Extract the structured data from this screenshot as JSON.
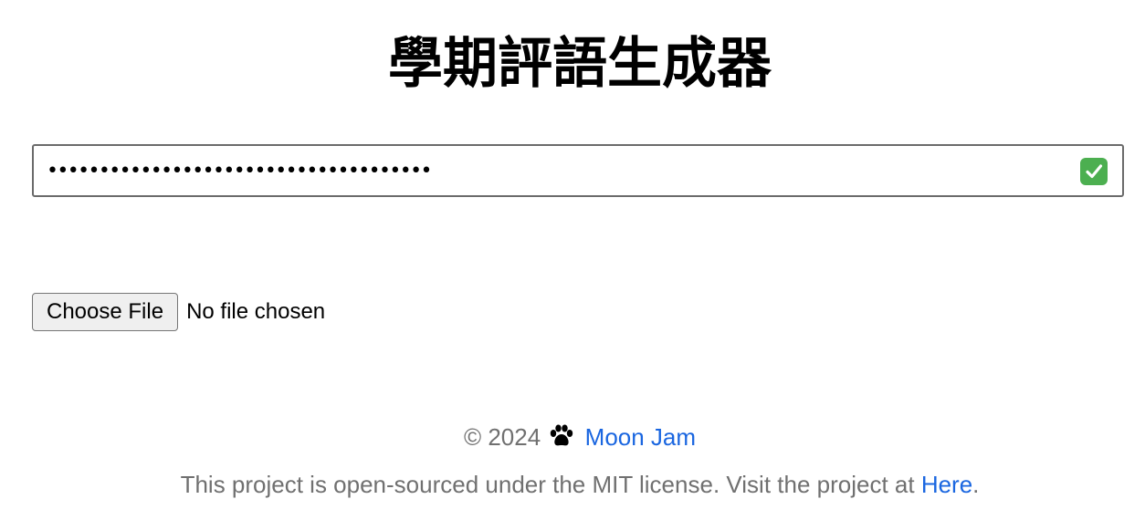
{
  "header": {
    "title": "學期評語生成器"
  },
  "api_key": {
    "value": "•••••••••••••••••••••••••••••••••••••",
    "status_icon": "check-mark-icon",
    "status_color": "#4caf50"
  },
  "file_input": {
    "button_label": "Choose File",
    "status_text": "No file chosen"
  },
  "footer": {
    "copyright": "© 2024",
    "paw_icon": "paw-icon",
    "author_link": "Moon Jam",
    "license_text": "This project is open-sourced under the MIT license. Visit the project at",
    "project_link": "Here",
    "trailing_period": ".",
    "link_color": "#1a66e0",
    "text_color": "#707070"
  }
}
